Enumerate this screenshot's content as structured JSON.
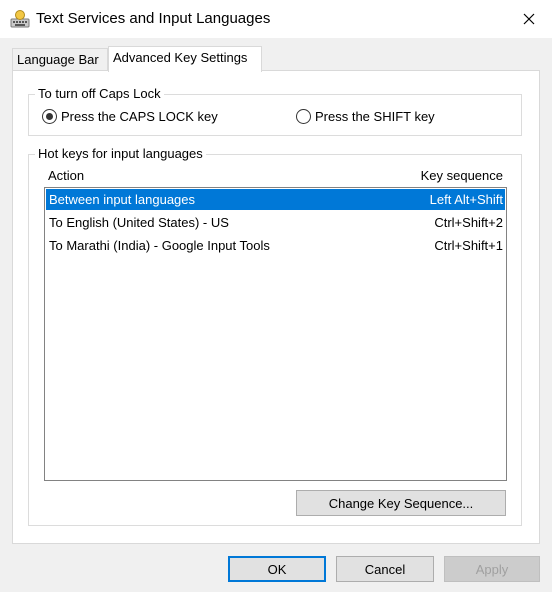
{
  "window": {
    "title": "Text Services and Input Languages",
    "close_icon": "close-icon",
    "app_icon": "keyboard-icon"
  },
  "tabs": [
    {
      "label": "Language Bar",
      "active": false
    },
    {
      "label": "Advanced Key Settings",
      "active": true
    }
  ],
  "caps_lock": {
    "title": "To turn off Caps Lock",
    "options": [
      {
        "label": "Press the CAPS LOCK key",
        "selected": true
      },
      {
        "label": "Press the SHIFT key",
        "selected": false
      }
    ]
  },
  "hotkeys": {
    "title": "Hot keys for input languages",
    "columns": {
      "action": "Action",
      "key_sequence": "Key sequence"
    },
    "rows": [
      {
        "action": "Between input languages",
        "keys": "Left Alt+Shift",
        "selected": true
      },
      {
        "action": "To English (United States) - US",
        "keys": "Ctrl+Shift+2",
        "selected": false
      },
      {
        "action": "To Marathi (India) - Google Input Tools",
        "keys": "Ctrl+Shift+1",
        "selected": false
      }
    ],
    "change_button": "Change Key Sequence..."
  },
  "footer": {
    "ok": "OK",
    "cancel": "Cancel",
    "apply": "Apply"
  },
  "colors": {
    "selection": "#0078d7",
    "default_button_border": "#0078d7"
  }
}
